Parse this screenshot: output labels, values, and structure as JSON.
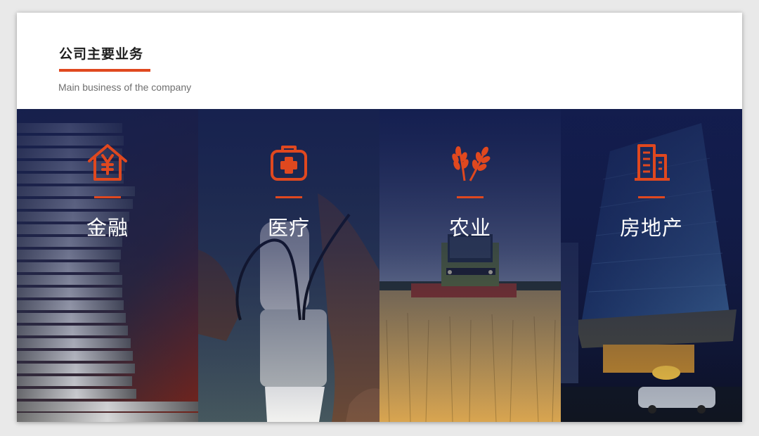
{
  "header": {
    "title": "公司主要业务",
    "subtitle": "Main business of the company",
    "accent_color": "#e0481f"
  },
  "panels": [
    {
      "label": "金融",
      "icon": "house-yen-icon",
      "scene": "stacked coins"
    },
    {
      "label": "医疗",
      "icon": "medical-kit-icon",
      "scene": "blood pressure measurement"
    },
    {
      "label": "农业",
      "icon": "wheat-icon",
      "scene": "harvester in wheat field"
    },
    {
      "label": "房地产",
      "icon": "building-icon",
      "scene": "skyscraper at night"
    }
  ]
}
